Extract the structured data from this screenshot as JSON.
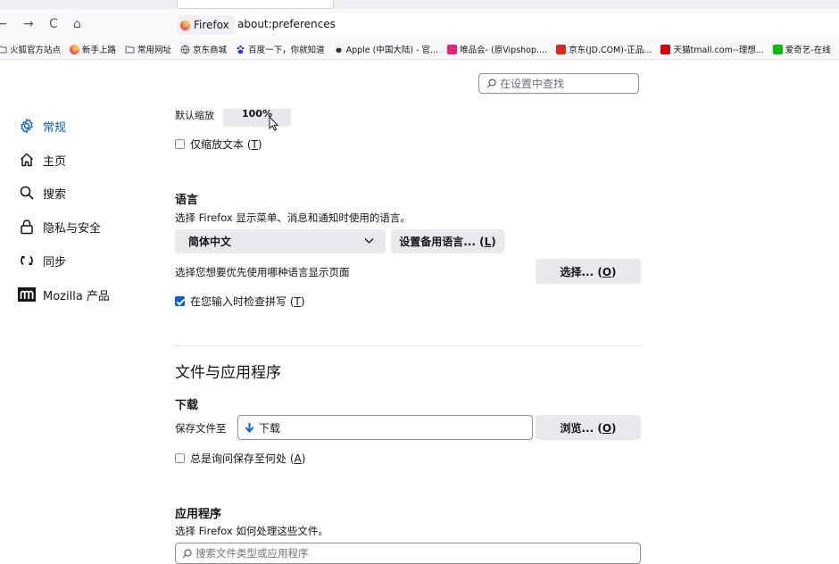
{
  "browser": {
    "tab_title": "Firefox",
    "url": "about:preferences",
    "nav": {
      "back": "←",
      "forward": "→",
      "reload": "C",
      "home": "⌂"
    }
  },
  "bookmarks": [
    {
      "label": "火狐官方站点",
      "icon": "folder-icon",
      "color": "#5b5b66"
    },
    {
      "label": "新手上路",
      "icon": "firefox-icon",
      "color": "#ff7139"
    },
    {
      "label": "常用网址",
      "icon": "folder-icon",
      "color": "#5b5b66"
    },
    {
      "label": "京东商城",
      "icon": "globe-icon",
      "color": "#5b5b66"
    },
    {
      "label": "百度一下，你就知道",
      "icon": "baidu-icon",
      "color": "#2932e1"
    },
    {
      "label": "Apple (中国大陆) - 官...",
      "icon": "apple-icon",
      "color": "#333333"
    },
    {
      "label": "唯品会- (原Vipshop....",
      "icon": "vip-icon",
      "color": "#e8207e"
    },
    {
      "label": "京东(JD.COM)-正品...",
      "icon": "jd-icon",
      "color": "#e1251b"
    },
    {
      "label": "天猫tmall.com--理想...",
      "icon": "tmall-icon",
      "color": "#d8000f"
    },
    {
      "label": "爱奇艺-在线",
      "icon": "iqiyi-icon",
      "color": "#00be06"
    }
  ],
  "search": {
    "placeholder": "在设置中查找"
  },
  "sidebar": [
    {
      "label": "常规",
      "icon": "gear-icon",
      "active": true
    },
    {
      "label": "主页",
      "icon": "home-icon",
      "active": false
    },
    {
      "label": "搜索",
      "icon": "search-icon",
      "active": false
    },
    {
      "label": "隐私与安全",
      "icon": "lock-icon",
      "active": false
    },
    {
      "label": "同步",
      "icon": "sync-icon",
      "active": false
    },
    {
      "label": "Mozilla 产品",
      "icon": "mozilla-icon",
      "active": false
    }
  ],
  "zoom": {
    "partial_label": "默认缩放",
    "partial_value": "100%",
    "text_only_label": "仅缩放文本",
    "text_only_key": "T",
    "text_only_checked": false
  },
  "language": {
    "heading": "语言",
    "description": "选择 Firefox 显示菜单、消息和通知时使用的语言。",
    "selected": "简体中文",
    "alt_button": "设置备用语言...",
    "alt_key": "L",
    "pages_label": "选择您想要优先使用哪种语言显示页面",
    "choose_button": "选择...",
    "choose_key": "O",
    "spell_label": "在您输入时检查拼写",
    "spell_key": "T",
    "spell_checked": true
  },
  "files_apps": {
    "section_title": "文件与应用程序",
    "downloads_heading": "下载",
    "save_to_label": "保存文件至",
    "save_to_value": "下载",
    "browse_button": "浏览...",
    "browse_key": "O",
    "always_ask_label": "总是询问保存至何处",
    "always_ask_key": "A",
    "always_ask_checked": false,
    "apps_heading": "应用程序",
    "apps_description": "选择 Firefox 如何处理这些文件。",
    "apps_search_placeholder": "搜索文件类型或应用程序"
  },
  "colors": {
    "accent": "#0061e0",
    "button_bg": "#e9e9ed",
    "text": "#15141a"
  }
}
